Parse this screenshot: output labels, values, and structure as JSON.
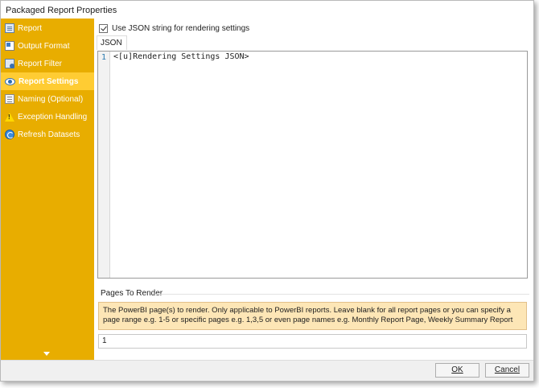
{
  "window": {
    "title": "Packaged Report Properties"
  },
  "sidebar": {
    "items": [
      {
        "label": "Report",
        "icon": "report-icon"
      },
      {
        "label": "Output Format",
        "icon": "output-format-icon"
      },
      {
        "label": "Report Filter",
        "icon": "report-filter-icon"
      },
      {
        "label": "Report Settings",
        "icon": "report-settings-icon",
        "active": true
      },
      {
        "label": "Naming (Optional)",
        "icon": "naming-icon"
      },
      {
        "label": "Exception Handling",
        "icon": "warning-icon"
      },
      {
        "label": "Refresh Datasets",
        "icon": "refresh-icon"
      }
    ],
    "collapse_icon": "chevron-down-icon"
  },
  "settings": {
    "use_json_label": "Use JSON string for rendering settings",
    "use_json_checked": true,
    "tab_label": "JSON",
    "editor": {
      "line_number": "1",
      "code": "<[u]Rendering Settings JSON>"
    }
  },
  "pages_to_render": {
    "section_title": "Pages To Render",
    "info_text": "The PowerBI page(s) to render. Only applicable to PowerBI reports. Leave blank for all report pages or you can specify a page range e.g. 1-5 or specific pages e.g. 1,3,5 or even page names e.g. Monthly Report Page, Weekly Summary Report",
    "value": "1"
  },
  "footer": {
    "ok_label": "OK",
    "cancel_label": "Cancel"
  },
  "colors": {
    "sidebar": "#e8ad00",
    "sidebar_active": "#ffcc33",
    "info_box": "#fde6b6"
  }
}
